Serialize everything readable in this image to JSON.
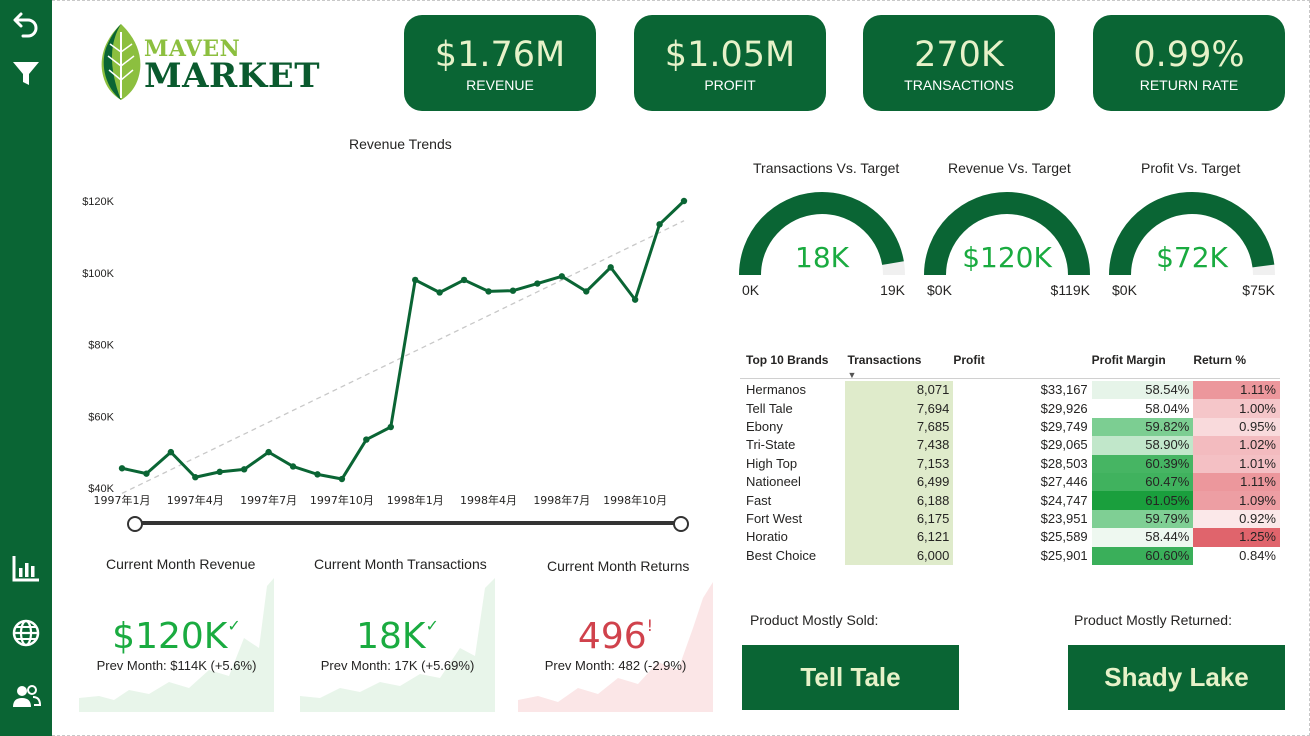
{
  "sidebar": {
    "icons": [
      "back-arrow-icon",
      "filter-icon",
      "bar-chart-icon",
      "globe-icon",
      "users-icon"
    ]
  },
  "logo": {
    "line1": "MAVEN",
    "line2": "MARKET"
  },
  "kpis": [
    {
      "value": "$1.76M",
      "label": "REVENUE"
    },
    {
      "value": "$1.05M",
      "label": "PROFIT"
    },
    {
      "value": "270K",
      "label": "TRANSACTIONS"
    },
    {
      "value": "0.99%",
      "label": "RETURN RATE"
    }
  ],
  "revenue_chart": {
    "title": "Revenue Trends",
    "y_ticks": [
      "$120K",
      "$100K",
      "$80K",
      "$60K",
      "$40K"
    ],
    "x_ticks": [
      "1997年1月",
      "1997年4月",
      "1997年7月",
      "1997年10月",
      "1998年1月",
      "1998年4月",
      "1998年7月",
      "1998年10月"
    ]
  },
  "chart_data": {
    "type": "line",
    "title": "Revenue Trends",
    "xlabel": "",
    "ylabel": "",
    "x": [
      "1997-01",
      "1997-02",
      "1997-03",
      "1997-04",
      "1997-05",
      "1997-06",
      "1997-07",
      "1997-08",
      "1997-09",
      "1997-10",
      "1997-11",
      "1997-12",
      "1998-01",
      "1998-02",
      "1998-03",
      "1998-04",
      "1998-05",
      "1998-06",
      "1998-07",
      "1998-08",
      "1998-09",
      "1998-10",
      "1998-11",
      "1998-12"
    ],
    "values": [
      45500,
      44000,
      50000,
      43000,
      44500,
      45200,
      50000,
      46000,
      43800,
      42500,
      53500,
      57000,
      98000,
      94500,
      98000,
      94800,
      95000,
      97000,
      99000,
      94800,
      101500,
      92500,
      113500,
      120000
    ],
    "trendline": {
      "from": 38500,
      "to": 114500,
      "style": "dashed"
    },
    "ylim": [
      40000,
      120000
    ],
    "grid": false,
    "color": "#0a6534"
  },
  "gauges": [
    {
      "title": "Transactions Vs. Target",
      "value": "18K",
      "min": "0K",
      "max": "19K",
      "fraction": 0.947
    },
    {
      "title": "Revenue Vs. Target",
      "value": "$120K",
      "min": "$0K",
      "max": "$119K",
      "fraction": 1.0
    },
    {
      "title": "Profit Vs. Target",
      "value": "$72K",
      "min": "$0K",
      "max": "$75K",
      "fraction": 0.96
    }
  ],
  "brand_table": {
    "headers": [
      "Top 10 Brands",
      "Transactions",
      "Profit",
      "Profit Margin",
      "Return %"
    ],
    "sort_indicator": "▼",
    "rows": [
      {
        "brand": "Hermanos",
        "tx": "8,071",
        "profit": "$33,167",
        "margin": "58.54%",
        "ret": "1.11%",
        "margin_bg": "#e6f4e9",
        "ret_bg": "#ec979c"
      },
      {
        "brand": "Tell Tale",
        "tx": "7,694",
        "profit": "$29,926",
        "margin": "58.04%",
        "ret": "1.00%",
        "margin_bg": "#ffffff",
        "ret_bg": "#f5c6c9"
      },
      {
        "brand": "Ebony",
        "tx": "7,685",
        "profit": "$29,749",
        "margin": "59.82%",
        "ret": "0.95%",
        "margin_bg": "#7cce92",
        "ret_bg": "#f9dadc"
      },
      {
        "brand": "Tri-State",
        "tx": "7,438",
        "profit": "$29,065",
        "margin": "58.90%",
        "ret": "1.02%",
        "margin_bg": "#c1e7ca",
        "ret_bg": "#f3bbbf"
      },
      {
        "brand": "High Top",
        "tx": "7,153",
        "profit": "$28,503",
        "margin": "60.39%",
        "ret": "1.01%",
        "margin_bg": "#46b563",
        "ret_bg": "#f4c0c4"
      },
      {
        "brand": "Nationeel",
        "tx": "6,499",
        "profit": "$27,446",
        "margin": "60.47%",
        "ret": "1.11%",
        "margin_bg": "#40b25e",
        "ret_bg": "#ec979c"
      },
      {
        "brand": "Fast",
        "tx": "6,188",
        "profit": "$24,747",
        "margin": "61.05%",
        "ret": "1.09%",
        "margin_bg": "#1a9f3d",
        "ret_bg": "#ed9ea3"
      },
      {
        "brand": "Fort West",
        "tx": "6,175",
        "profit": "$23,951",
        "margin": "59.79%",
        "ret": "0.92%",
        "margin_bg": "#7fcf94",
        "ret_bg": "#fbe8e9"
      },
      {
        "brand": "Horatio",
        "tx": "6,121",
        "profit": "$25,589",
        "margin": "58.44%",
        "ret": "1.25%",
        "margin_bg": "#eef8f0",
        "ret_bg": "#e0646c"
      },
      {
        "brand": "Best Choice",
        "tx": "6,000",
        "profit": "$25,901",
        "margin": "60.60%",
        "ret": "0.84%",
        "margin_bg": "#3aaf5a",
        "ret_bg": "#ffffff"
      }
    ]
  },
  "current_month": [
    {
      "title": "Current Month Revenue",
      "value": "$120K",
      "mark": "✓",
      "prev": "Prev Month: $114K (+5.6%)",
      "color": "#1aab40"
    },
    {
      "title": "Current Month Transactions",
      "value": "18K",
      "mark": "✓",
      "prev": "Prev Month: 17K (+5.69%)",
      "color": "#1aab40"
    },
    {
      "title": "Current Month Returns",
      "value": "496",
      "mark": "!",
      "prev": "Prev Month: 482 (-2.9%)",
      "color": "#d0424c"
    }
  ],
  "products": {
    "sold_label": "Product Mostly Sold:",
    "sold_value": "Tell Tale",
    "returned_label": "Product Mostly Returned:",
    "returned_value": "Shady Lake"
  }
}
